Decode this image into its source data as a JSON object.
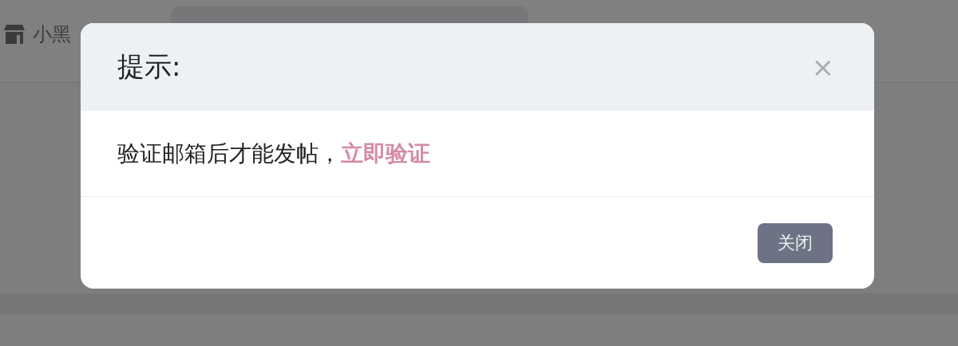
{
  "page": {
    "brand": "小黑"
  },
  "dialog": {
    "title": "提示:",
    "close": "×",
    "message": "验证邮箱后才能发帖，",
    "link": "立即验证",
    "buttons": [
      "关闭"
    ]
  }
}
